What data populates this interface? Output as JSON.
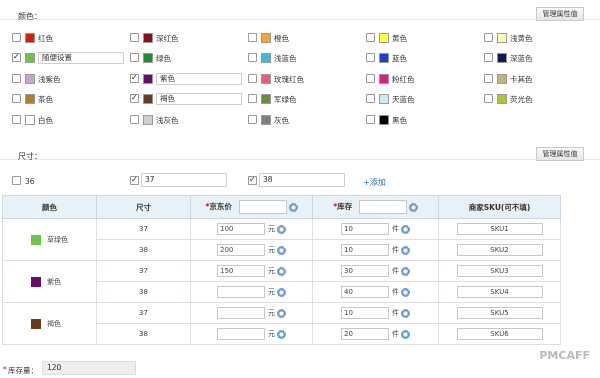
{
  "color_section": {
    "title": "颜色：",
    "manage_label": "管理属性值",
    "items": [
      {
        "label": "红色",
        "color": "#d81e06",
        "checked": false
      },
      {
        "label": "深红色",
        "color": "#8b0f0f",
        "checked": false
      },
      {
        "label": "橙色",
        "color": "#f5a623",
        "checked": false
      },
      {
        "label": "黄色",
        "color": "#ffff33",
        "checked": false
      },
      {
        "label": "浅黄色",
        "color": "#ffffa8",
        "checked": false
      },
      {
        "label": "随便设置",
        "color": "#6cc644",
        "checked": true,
        "custom": true
      },
      {
        "label": "绿色",
        "color": "#1a8f2a",
        "checked": false
      },
      {
        "label": "浅蓝色",
        "color": "#3bb8e8",
        "checked": false
      },
      {
        "label": "蓝色",
        "color": "#1d3fd1",
        "checked": false
      },
      {
        "label": "深蓝色",
        "color": "#0c1a5c",
        "checked": false
      },
      {
        "label": "浅紫色",
        "color": "#c9a0dc",
        "checked": false
      },
      {
        "label": "紫色",
        "color": "#6a0a6e",
        "checked": true,
        "custom": true
      },
      {
        "label": "玫瑰红色",
        "color": "#e8607a",
        "checked": false
      },
      {
        "label": "粉红色",
        "color": "#e8177f",
        "checked": false
      },
      {
        "label": "卡其色",
        "color": "#c3b37a",
        "checked": false
      },
      {
        "label": "茶色",
        "color": "#b07e2a",
        "checked": false
      },
      {
        "label": "褐色",
        "color": "#6b3a1a",
        "checked": true,
        "custom": true
      },
      {
        "label": "军绿色",
        "color": "#6b8e3a",
        "checked": false
      },
      {
        "label": "天蓝色",
        "color": "#c8f0f8",
        "checked": false
      },
      {
        "label": "荧光色",
        "color": "#a8c83a",
        "checked": false
      },
      {
        "label": "白色",
        "color": "#ffffff",
        "checked": false
      },
      {
        "label": "浅灰色",
        "color": "#cfcfcf",
        "checked": false
      },
      {
        "label": "灰色",
        "color": "#808080",
        "checked": false
      },
      {
        "label": "黑色",
        "color": "#000000",
        "checked": false
      }
    ]
  },
  "size_section": {
    "title": "尺寸：",
    "manage_label": "管理属性值",
    "items": [
      {
        "label": "36",
        "checked": false
      },
      {
        "label": "37",
        "checked": true
      },
      {
        "label": "38",
        "checked": true
      }
    ],
    "add_label": "+添加"
  },
  "table": {
    "headers": {
      "color": "颜色",
      "size": "尺寸",
      "price_req": "*",
      "price": "京东价",
      "stock_req": "*",
      "stock": "库存",
      "sku": "商家SKU(可不填)"
    },
    "price_unit": "元",
    "stock_unit": "件",
    "groups": [
      {
        "color": "草绿色",
        "swatch": "#6cc644",
        "rows": [
          {
            "size": "37",
            "price": "100",
            "stock": "10",
            "sku": "SKU1"
          },
          {
            "size": "38",
            "price": "200",
            "stock": "10",
            "sku": "SKU2"
          }
        ]
      },
      {
        "color": "紫色",
        "swatch": "#6a0a6e",
        "rows": [
          {
            "size": "37",
            "price": "150",
            "stock": "30",
            "sku": "SKU3"
          },
          {
            "size": "38",
            "price": "",
            "stock": "40",
            "sku": "SKU4"
          }
        ]
      },
      {
        "color": "褐色",
        "swatch": "#6b3a1a",
        "rows": [
          {
            "size": "37",
            "price": "",
            "stock": "10",
            "sku": "SKU5"
          },
          {
            "size": "38",
            "price": "",
            "stock": "20",
            "sku": "SKU6"
          }
        ]
      }
    ]
  },
  "stock_total": {
    "req": "*",
    "label": "库存量：",
    "value": "120"
  },
  "watermark": "PMCAFF"
}
